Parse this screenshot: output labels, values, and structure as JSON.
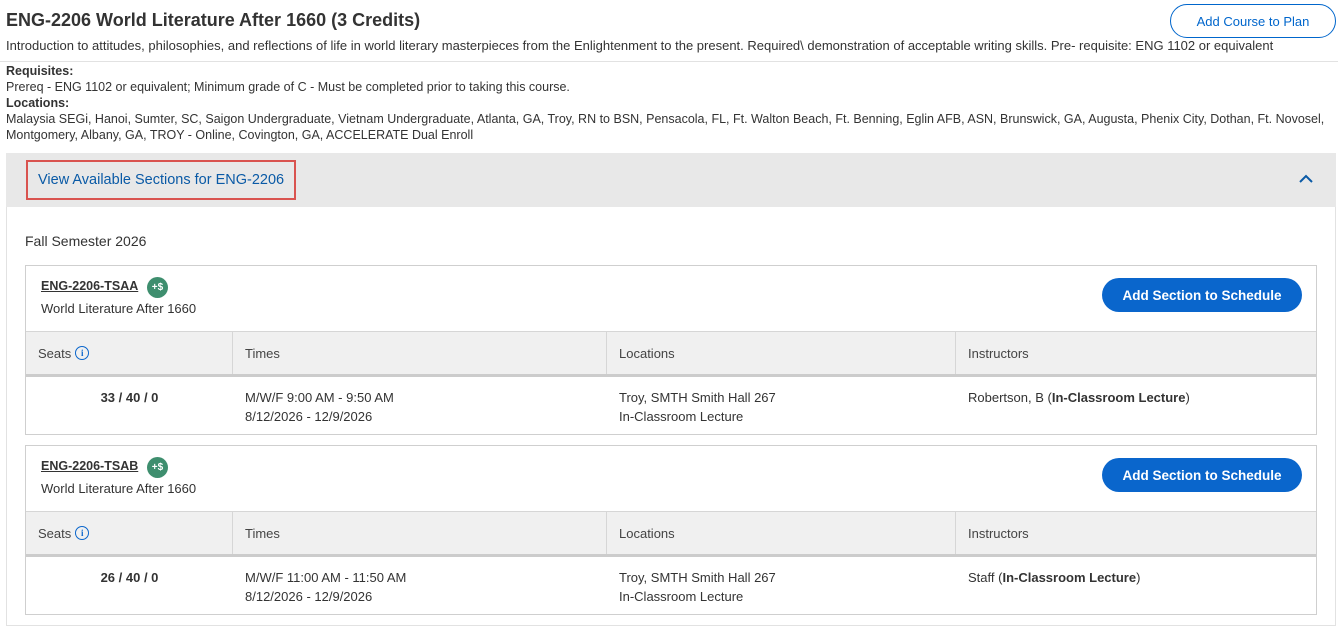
{
  "course": {
    "title": "ENG-2206 World Literature After 1660 (3 Credits)",
    "description": "Introduction to attitudes, philosophies, and reflections of life in world literary masterpieces from the Enlightenment to the present. Required\\ demonstration of acceptable writing skills. Pre- requisite: ENG 1102 or equivalent",
    "add_plan_label": "Add Course to Plan",
    "requisites_label": "Requisites:",
    "requisites_text": "Prereq - ENG 1102 or equivalent; Minimum grade of C - Must be completed prior to taking this course.",
    "locations_label": "Locations:",
    "locations_text": "Malaysia SEGi, Hanoi, Sumter, SC, Saigon Undergraduate, Vietnam Undergraduate, Atlanta, GA, Troy, RN to BSN, Pensacola, FL, Ft. Walton Beach, Ft. Benning, Eglin AFB, ASN, Brunswick, GA, Augusta, Phenix City, Dothan, Ft. Novosel, Montgomery, Albany, GA, TROY - Online, Covington, GA, ACCELERATE Dual Enroll"
  },
  "sections_panel": {
    "toggle_label": "View Available Sections for ENG-2206",
    "chevron_icon": "chevron-up-icon",
    "semester": "Fall Semester 2026"
  },
  "table_headers": {
    "seats": "Seats",
    "times": "Times",
    "locations": "Locations",
    "instructors": "Instructors"
  },
  "sections": [
    {
      "code": "ENG-2206-TSAA",
      "fee_badge": "+$",
      "name": "World Literature After 1660",
      "add_label": "Add Section to Schedule",
      "seats": "33 / 40 / 0",
      "time": "M/W/F 9:00 AM - 9:50 AM",
      "dates": "8/12/2026 - 12/9/2026",
      "location": "Troy, SMTH Smith Hall 267",
      "method": "In-Classroom Lecture",
      "instructor": "Robertson, B (",
      "instructor_method": "In-Classroom Lecture",
      "instructor_close": ")"
    },
    {
      "code": "ENG-2206-TSAB",
      "fee_badge": "+$",
      "name": "World Literature After 1660",
      "add_label": "Add Section to Schedule",
      "seats": "26 / 40 / 0",
      "time": "M/W/F 11:00 AM - 11:50 AM",
      "dates": "8/12/2026 - 12/9/2026",
      "location": "Troy, SMTH Smith Hall 267",
      "method": "In-Classroom Lecture",
      "instructor": "Staff (",
      "instructor_method": "In-Classroom Lecture",
      "instructor_close": ")"
    }
  ]
}
